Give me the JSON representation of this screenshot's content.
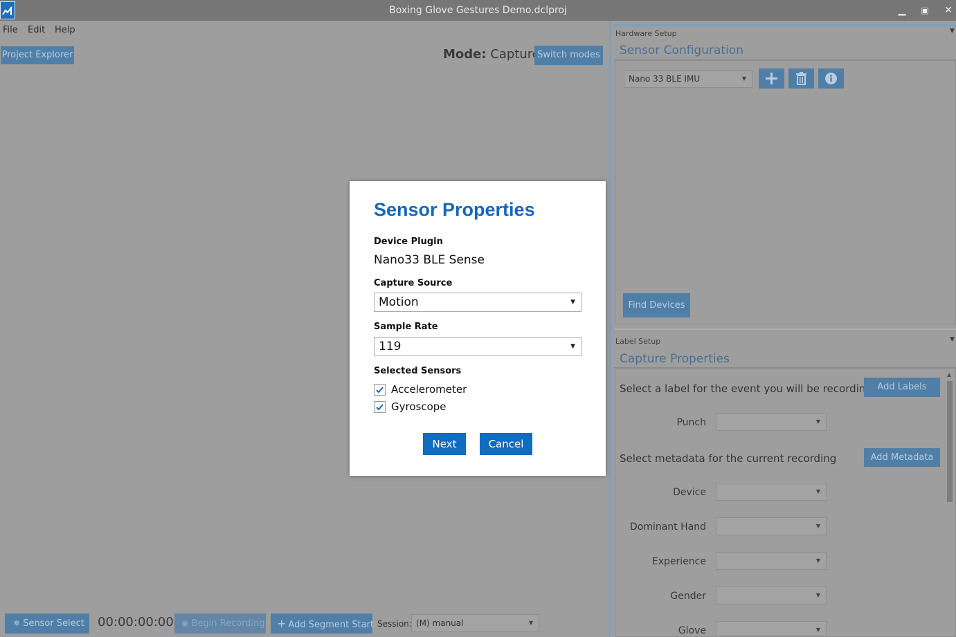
{
  "window": {
    "title": "Boxing Glove Gestures Demo.dclproj",
    "minimize_icon": "minimize-icon",
    "maximize_icon": "maximize-icon",
    "close_icon": "close-icon"
  },
  "menu": {
    "file": "File",
    "edit": "Edit",
    "help": "Help"
  },
  "toolbar": {
    "project_explorer": "Project Explorer",
    "mode_prefix": "Mode:",
    "mode_value": "Capture",
    "switch_modes": "Switch modes"
  },
  "hardware": {
    "section": "Hardware Setup",
    "title": "Sensor Configuration",
    "device_select": "Nano 33 BLE IMU",
    "find_devices": "Find Devices"
  },
  "label_setup": {
    "section": "Label Setup",
    "title": "Capture Properties",
    "label_prompt": "Select a label for the event you will be recording",
    "add_labels": "Add Labels",
    "label_fields": [
      {
        "label": "Punch",
        "value": ""
      }
    ],
    "metadata_prompt": "Select metadata for the current recording",
    "add_metadata": "Add Metadata",
    "metadata_fields": [
      {
        "label": "Device",
        "value": ""
      },
      {
        "label": "Dominant Hand",
        "value": ""
      },
      {
        "label": "Experience",
        "value": ""
      },
      {
        "label": "Gender",
        "value": ""
      },
      {
        "label": "Glove",
        "value": ""
      }
    ]
  },
  "bottom": {
    "sensor_select": "Sensor Select",
    "timer": "00:00:00:00",
    "begin_recording": "Begin Recording",
    "add_segment_start": "Add Segment Start",
    "session_label": "Session:",
    "session_value": "(M) manual"
  },
  "modal": {
    "title": "Sensor Properties",
    "device_plugin_label": "Device Plugin",
    "device_plugin_value": "Nano33 BLE Sense",
    "capture_source_label": "Capture Source",
    "capture_source_value": "Motion",
    "sample_rate_label": "Sample Rate",
    "sample_rate_value": "119",
    "selected_sensors_label": "Selected Sensors",
    "sensors": [
      {
        "name": "Accelerometer",
        "checked": true
      },
      {
        "name": "Gyroscope",
        "checked": true
      }
    ],
    "next": "Next",
    "cancel": "Cancel"
  },
  "colors": {
    "accent": "#1767b8",
    "button": "#0f6cbf",
    "dim_button": "#4f7fa6",
    "overlay": "#9e9e9e"
  }
}
